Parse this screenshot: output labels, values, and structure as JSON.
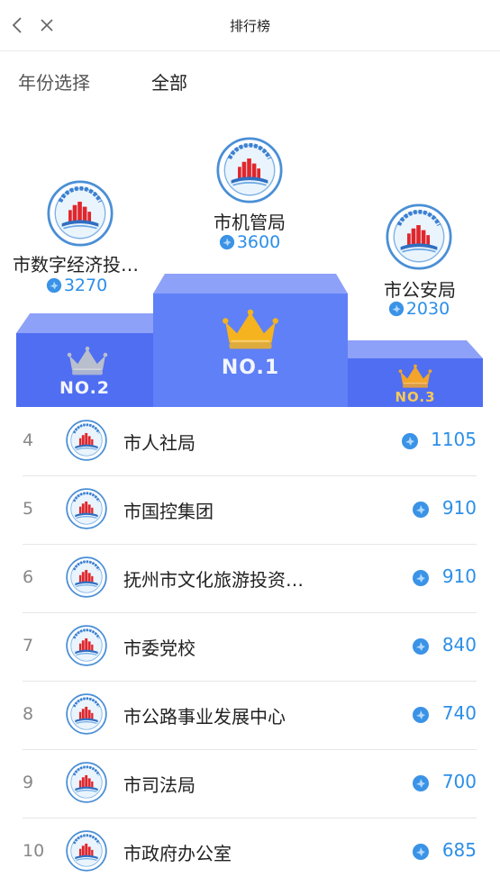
{
  "header": {
    "title": "排行榜",
    "back_icon": "chevron-left-icon",
    "close_icon": "close-icon"
  },
  "filter": {
    "label": "年份选择",
    "value": "全部"
  },
  "podium": {
    "first": {
      "name": "市机管局",
      "score": "3600",
      "badge": "NO.1"
    },
    "second": {
      "name": "市数字经济投…",
      "score": "3270",
      "badge": "NO.2"
    },
    "third": {
      "name": "市公安局",
      "score": "2030",
      "badge": "NO.3"
    }
  },
  "ranking": [
    {
      "rank": "4",
      "name": "市人社局",
      "score": "1105"
    },
    {
      "rank": "5",
      "name": "市国控集团",
      "score": "910"
    },
    {
      "rank": "6",
      "name": "抚州市文化旅游投资…",
      "score": "910"
    },
    {
      "rank": "7",
      "name": "市委党校",
      "score": "840"
    },
    {
      "rank": "8",
      "name": "市公路事业发展中心",
      "score": "740"
    },
    {
      "rank": "9",
      "name": "市司法局",
      "score": "700"
    },
    {
      "rank": "10",
      "name": "市政府办公室",
      "score": "685"
    }
  ],
  "colors": {
    "accent": "#2c8fe8",
    "podium_blue": "#4f6ef2",
    "podium_top": "#8ea1f8",
    "gold": "#f5b31f",
    "silver": "#b9bfcc"
  }
}
